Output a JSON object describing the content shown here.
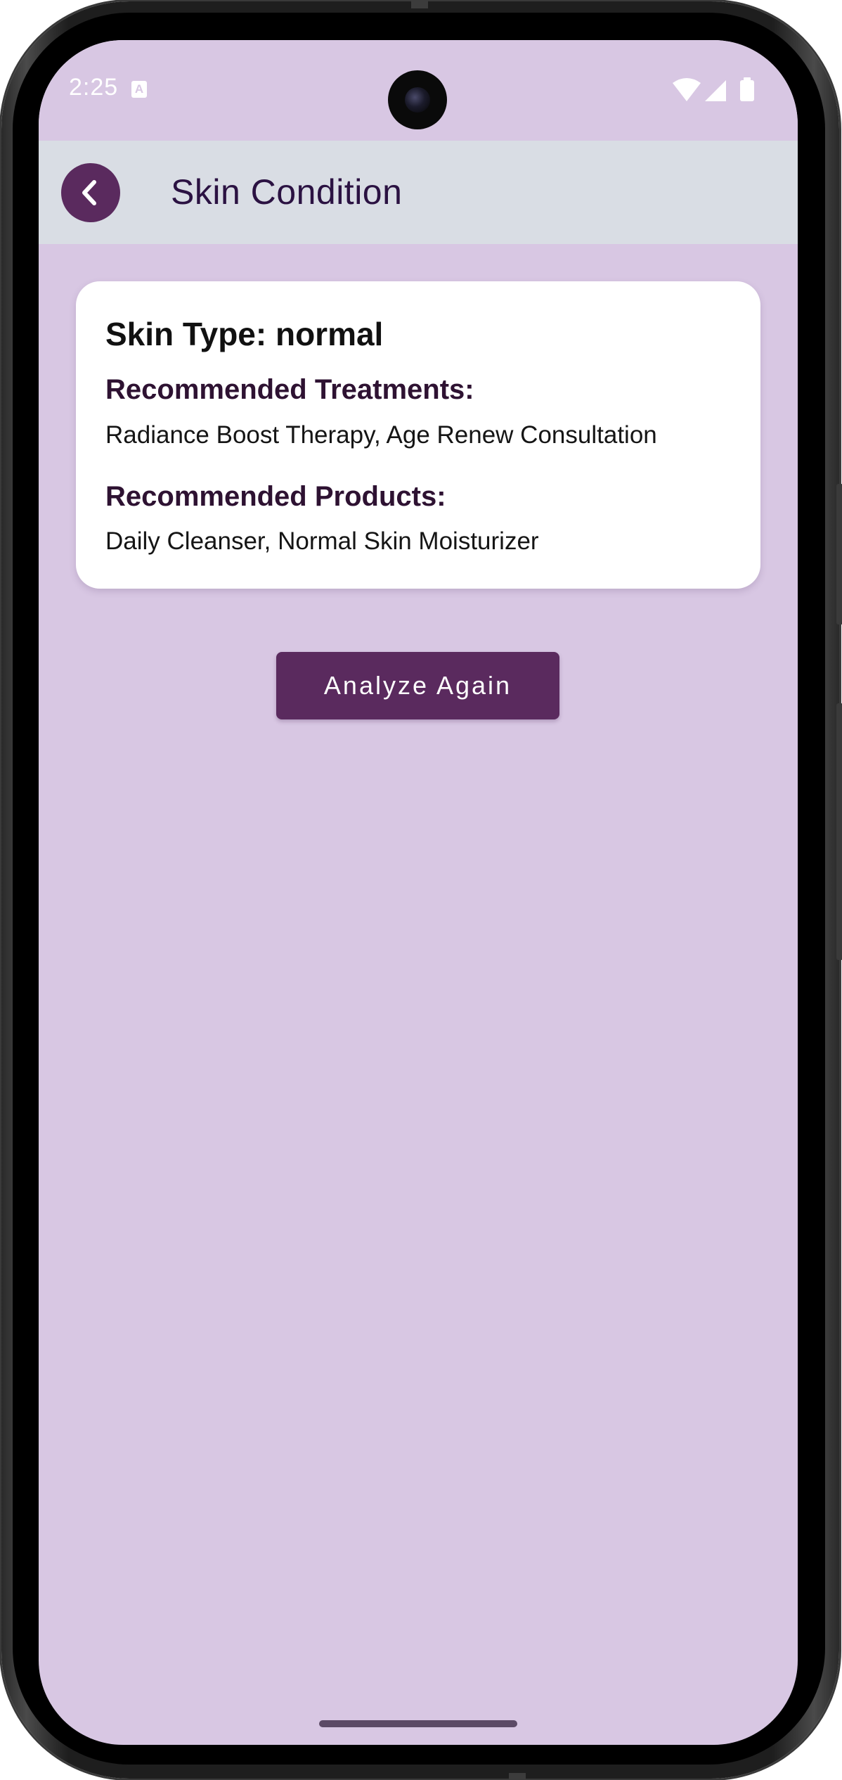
{
  "status_bar": {
    "time": "2:25",
    "notification_icon": "A",
    "icons": [
      "wifi-icon",
      "signal-icon",
      "battery-icon"
    ]
  },
  "app_bar": {
    "back_icon": "chevron-left-icon",
    "title": "Skin Condition"
  },
  "result_card": {
    "skin_type": "Skin Type: normal",
    "treatments_heading": "Recommended Treatments:",
    "treatments_text": "Radiance Boost Therapy, Age Renew Consultation",
    "products_heading": "Recommended Products:",
    "products_text": "Daily Cleanser, Normal Skin Moisturizer"
  },
  "actions": {
    "analyze_again_label": "Analyze Again"
  },
  "colors": {
    "background": "#d8c7e3",
    "app_bar": "#d9dde4",
    "accent": "#5a2a5e",
    "title_text": "#2b1242",
    "card": "#ffffff"
  }
}
